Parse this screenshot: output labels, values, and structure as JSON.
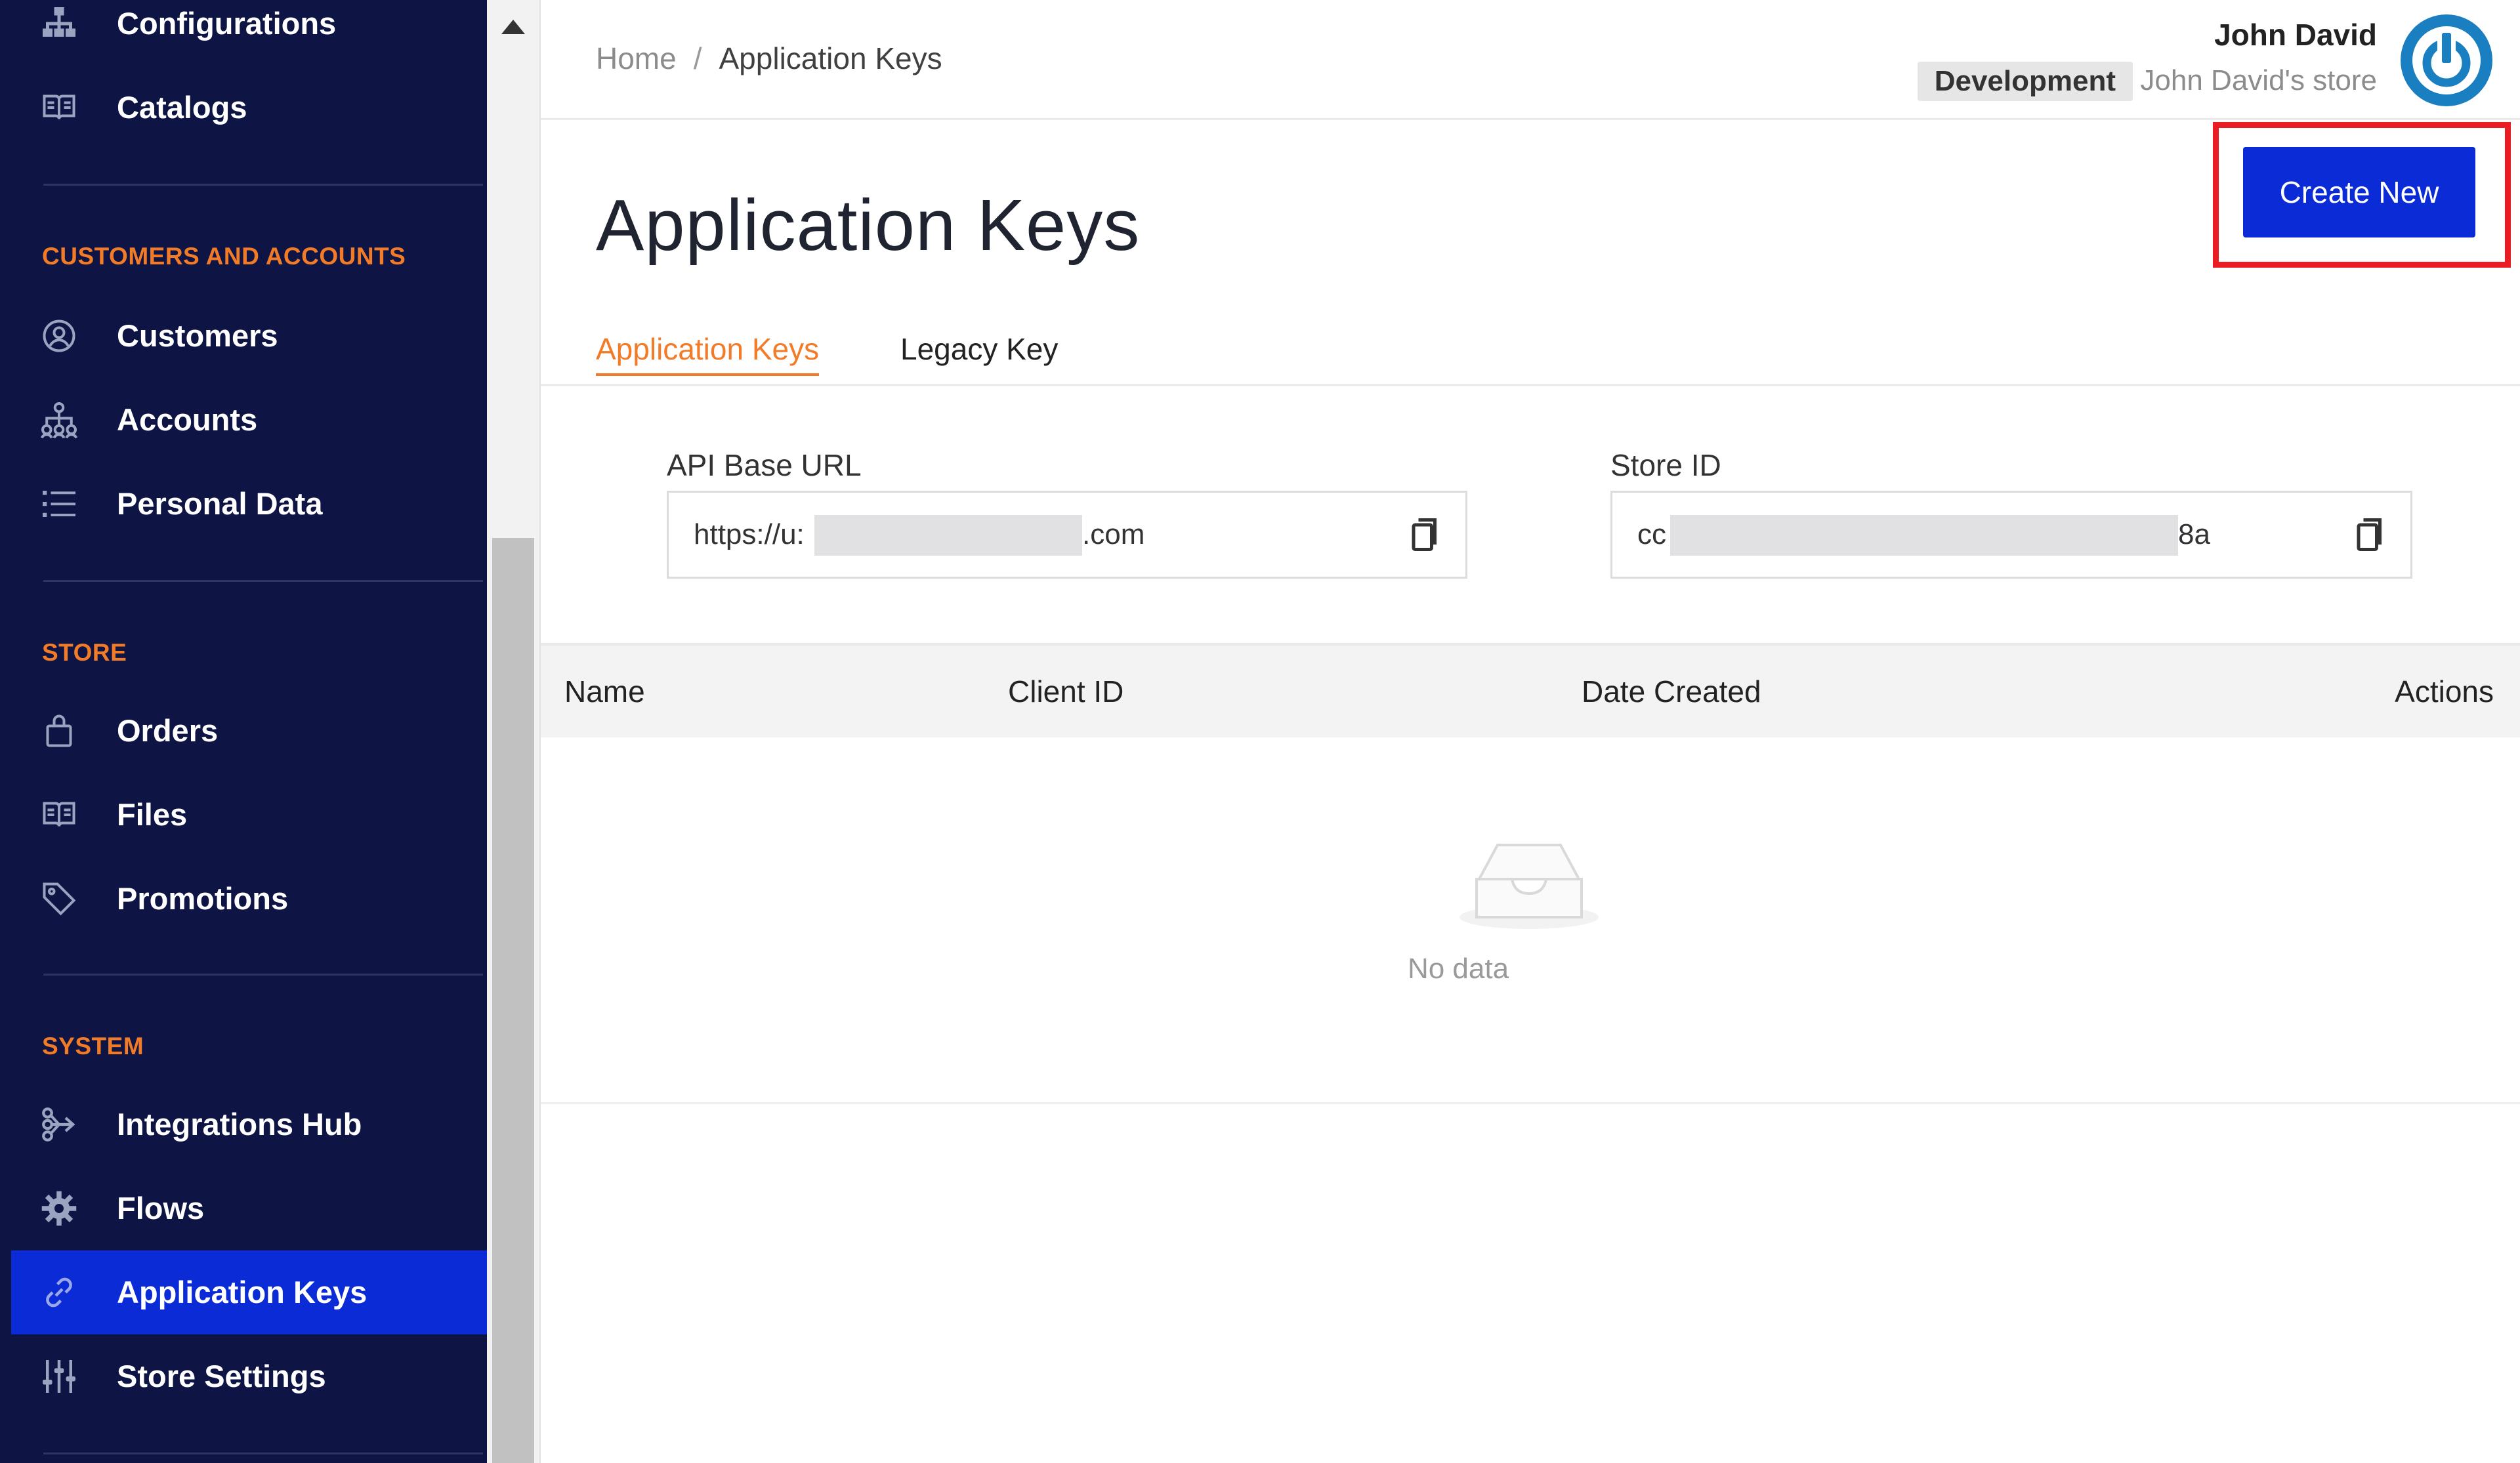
{
  "sidebar": {
    "items_top": [
      {
        "label": "Configurations",
        "icon": "hierarchy-icon"
      },
      {
        "label": "Catalogs",
        "icon": "book-icon"
      }
    ],
    "sections": [
      {
        "title": "CUSTOMERS AND ACCOUNTS",
        "items": [
          {
            "label": "Customers",
            "icon": "user-circle-icon"
          },
          {
            "label": "Accounts",
            "icon": "org-chart-icon"
          },
          {
            "label": "Personal Data",
            "icon": "list-icon"
          }
        ]
      },
      {
        "title": "STORE",
        "items": [
          {
            "label": "Orders",
            "icon": "bag-icon"
          },
          {
            "label": "Files",
            "icon": "book-icon"
          },
          {
            "label": "Promotions",
            "icon": "tag-icon"
          }
        ]
      },
      {
        "title": "SYSTEM",
        "items": [
          {
            "label": "Integrations Hub",
            "icon": "integrations-icon"
          },
          {
            "label": "Flows",
            "icon": "gear-icon"
          },
          {
            "label": "Application Keys",
            "icon": "key-link-icon",
            "active": true
          },
          {
            "label": "Store Settings",
            "icon": "sliders-icon"
          }
        ]
      }
    ]
  },
  "header": {
    "breadcrumb": {
      "home": "Home",
      "separator": "/",
      "current": "Application Keys"
    },
    "user_name": "John David",
    "environment": "Development",
    "store_name": "John David's store",
    "avatar_icon": "power-icon"
  },
  "page": {
    "title": "Application Keys",
    "create_button": "Create New",
    "tabs": [
      {
        "label": "Application Keys",
        "active": true
      },
      {
        "label": "Legacy Key",
        "active": false
      }
    ],
    "api_base_url": {
      "label": "API Base URL",
      "value_prefix": "https://u:",
      "value_suffix": ".com"
    },
    "store_id": {
      "label": "Store ID",
      "value_prefix": "cc",
      "value_suffix": "8a"
    },
    "table": {
      "columns": [
        "Name",
        "Client ID",
        "Date Created",
        "Actions"
      ],
      "empty_text": "No data"
    }
  },
  "colors": {
    "sidebar_bg": "#0e1544",
    "active_item": "#0a2bd6",
    "section_heading": "#f27b28",
    "primary_button": "#0a2bd6",
    "highlight_border": "#ea1c24",
    "avatar": "#1a7fc1"
  }
}
